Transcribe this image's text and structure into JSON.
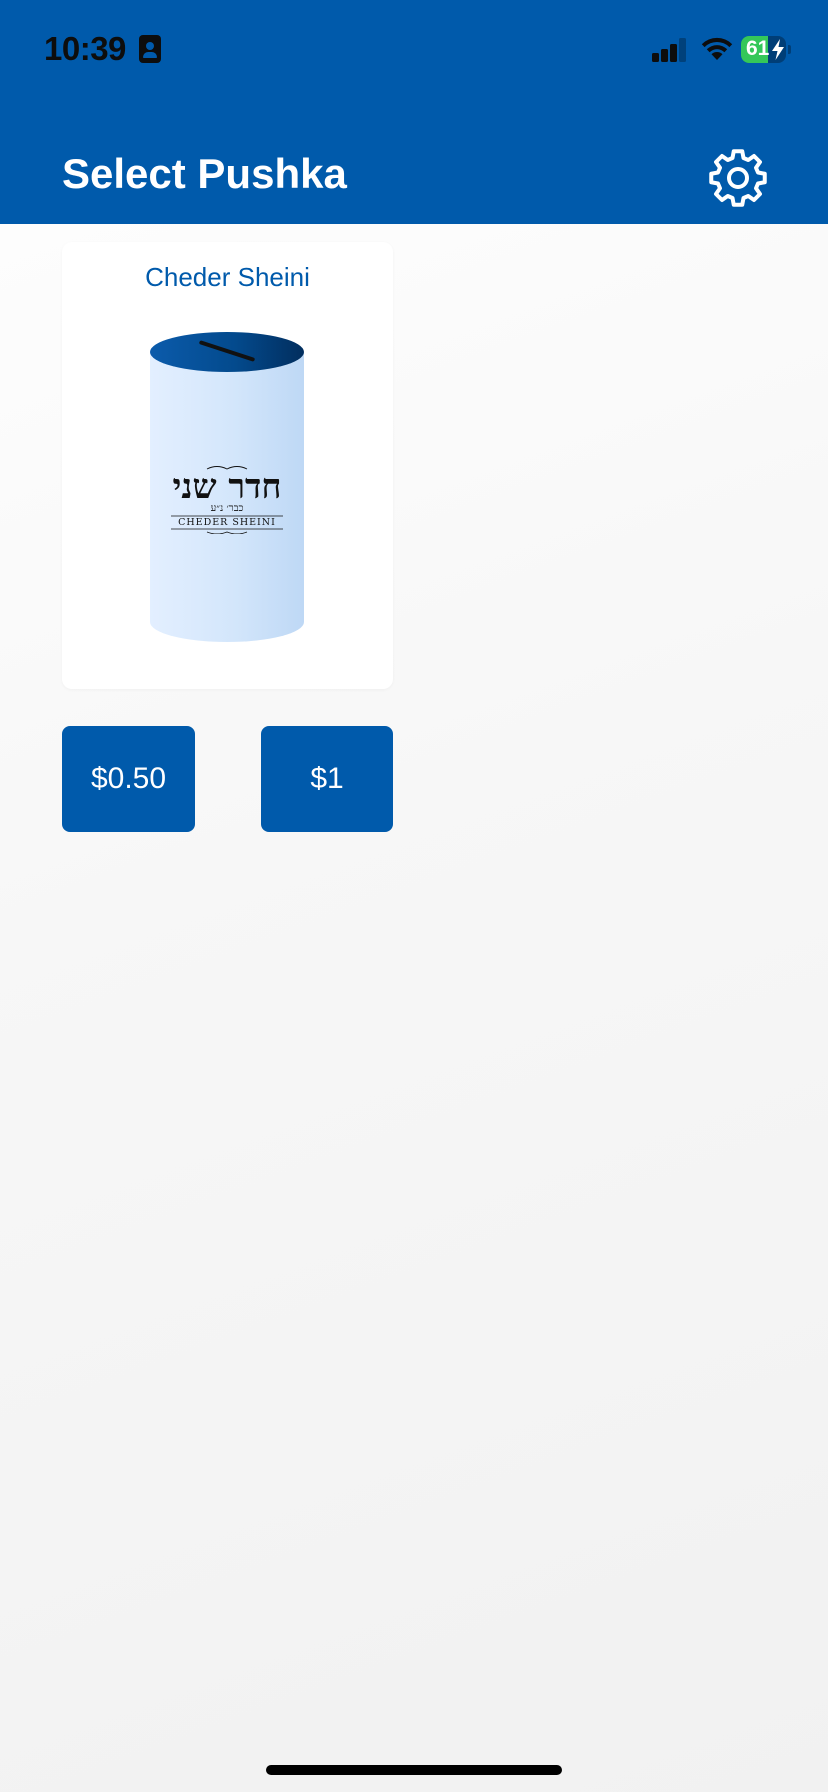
{
  "status_bar": {
    "time": "10:39",
    "battery_level": "61",
    "battery_fraction": 0.61,
    "signal_bars": 3,
    "signal_bars_total": 4,
    "icons": [
      "id-badge-icon",
      "cellular-signal-icon",
      "wifi-icon",
      "battery-charging-icon"
    ]
  },
  "header": {
    "title": "Select Pushka",
    "settings_icon": "gear-icon"
  },
  "pushkas": [
    {
      "name": "Cheder Sheini",
      "logo_hebrew": "חדר שני",
      "logo_subtitle_hebrew": "כבר׳ נ״ע",
      "logo_english": "CHEDER SHEINI"
    }
  ],
  "amounts": [
    {
      "label": "$0.50"
    },
    {
      "label": "$1"
    }
  ],
  "colors": {
    "primary": "#005aab",
    "status_text": "#0d0d0d",
    "battery_green": "#34c759",
    "background": "#f5f5f5"
  }
}
